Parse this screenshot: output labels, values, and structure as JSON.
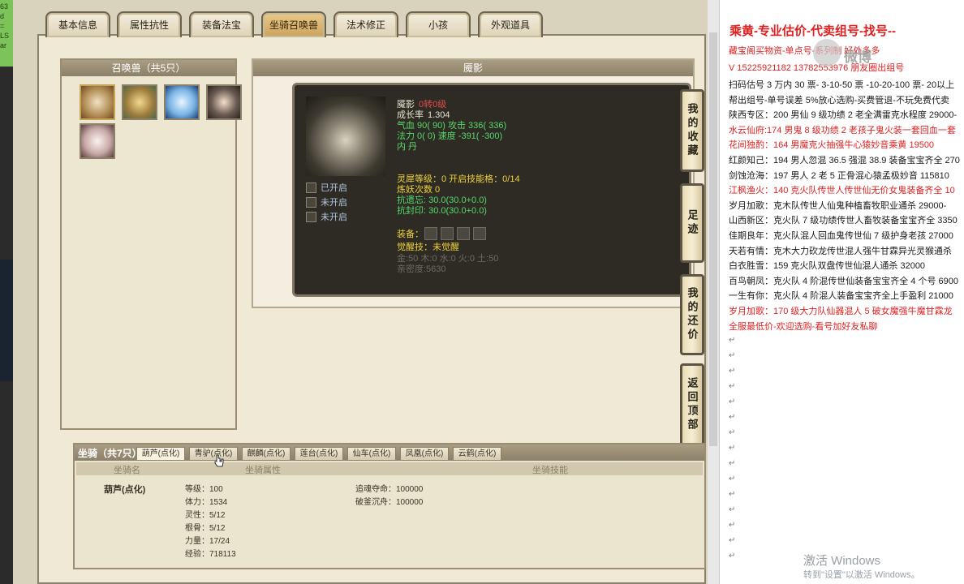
{
  "left_strip_text": "63\nd\n=\nLS\nar",
  "tabs": [
    "基本信息",
    "属性抗性",
    "装备法宝",
    "坐骑召唤兽",
    "法术修正",
    "小孩",
    "外观道具"
  ],
  "active_tab": "坐骑召唤兽",
  "summon_header": "召唤兽（共5只）",
  "detail_header": "魇影",
  "pet": {
    "name": "魇影",
    "rebirth": "0转0级",
    "growth_label": "成长率",
    "growth": "1.304",
    "hp_line": "气血 90( 90) 攻击 336( 336)",
    "mp_line": "法力 0( 0) 速度 -391( -300)",
    "core_label": "内  丹",
    "spirit_line": "灵犀等级：0 开启技能格：0/14",
    "refine_line": "炼妖次数 0",
    "resist1": "抗遗忘: 30.0(30.0+0.0)",
    "resist2": "抗封印: 30.0(30.0+0.0)",
    "locks": [
      "已开启",
      "未开启",
      "未开启"
    ],
    "equip_label": "装备：",
    "awaken_line": "觉醒技：未觉醒",
    "elements": "金:50 木:0 水:0 火:0 土:50",
    "intimacy": "亲密度:5630"
  },
  "side_buttons": [
    "我的收藏",
    "足迹",
    "我的还价",
    "返回顶部"
  ],
  "mount": {
    "title": "坐骑（共7只）",
    "tabs": [
      "葫芦(点化)",
      "青驴(点化)",
      "麒麟(点化)",
      "莲台(点化)",
      "仙车(点化)",
      "凤凰(点化)",
      "云鹤(点化)"
    ],
    "headers": [
      "坐骑名",
      "坐骑属性",
      "坐骑技能"
    ],
    "name": "葫芦(点化)",
    "attrs": [
      "等级：100",
      "体力：1534",
      "灵性：5/12",
      "根骨：5/12",
      "力量：17/24",
      "经验：718113"
    ],
    "skills": [
      "追魂夺命：100000",
      "破釜沉舟：100000"
    ]
  },
  "doc": {
    "title": "乘黄-专业估价-代卖组号-找号--",
    "lines": [
      {
        "text": "藏宝阁买物资-单点号-系列制 好处多多",
        "color": "red"
      },
      {
        "text": "V 15225921182    13782553976 朋友圈出组号",
        "color": "red"
      },
      {
        "text": "扫码估号 3 万内 30 票- 3-10-50 票  -10-20-100 票- 20以上",
        "color": "blk"
      },
      {
        "text": "帮出组号-单号误差 5%放心选购-买费管退-不玩免费代卖",
        "color": "blk"
      },
      {
        "text": "陕西专区：200 男仙 9 级功绩 2 老全满雷克水程度 29000-",
        "color": "blk"
      },
      {
        "text": "水云仙府:174 男鬼 8 级功绩 2 老孩子鬼火装一套回血一套",
        "color": "red"
      },
      {
        "text": "花间独酌：164 男魔克火抽强牛心猿妙音乘黄 19500",
        "color": "red"
      },
      {
        "text": "红颜知己：194 男人忽混 36.5 强混 38.9 装备宝宝齐全 270",
        "color": "blk"
      },
      {
        "text": "剑蚀沧海：197 男人 2 老 5 正骨混心猿孟极妙音 115810",
        "color": "blk"
      },
      {
        "text": "江枫渔火：140 克火队传世人传世仙无价女鬼装备齐全 10",
        "color": "red"
      },
      {
        "text": "岁月加歌：克木队传世人仙鬼种植畜牧职业通杀 29000-",
        "color": "blk"
      },
      {
        "text": "山西新区：克火队 7 级功绩传世人畜牧装备宝宝齐全 3350",
        "color": "blk"
      },
      {
        "text": "佳期良年：克火队混人回血鬼传世仙 7 级护身老孩 27000",
        "color": "blk"
      },
      {
        "text": "天若有情：克木大力砍龙传世混人强牛甘霖异光灵猴通杀",
        "color": "blk"
      },
      {
        "text": "白衣胜雪：159 克火队双盘传世仙混人通杀 32000",
        "color": "blk"
      },
      {
        "text": "百鸟朝凤：克火队 4 阶混传世仙装备宝宝齐全 4 个号 6900",
        "color": "blk"
      },
      {
        "text": "一生有你：克火队 4 阶混人装备宝宝齐全上手盈利 21000",
        "color": "blk"
      },
      {
        "text": "岁月加歌：170 级大力队仙器混人 5 破女魔强牛魔甘霖龙",
        "color": "red"
      },
      {
        "text": "全服最低价-欢迎选购-看号加好友私聊",
        "color": "red"
      }
    ],
    "para_mark": "↵",
    "wb_text": "微博",
    "activate1": "激活 Windows",
    "activate2": "转到\"设置\"以激活 Windows。"
  }
}
